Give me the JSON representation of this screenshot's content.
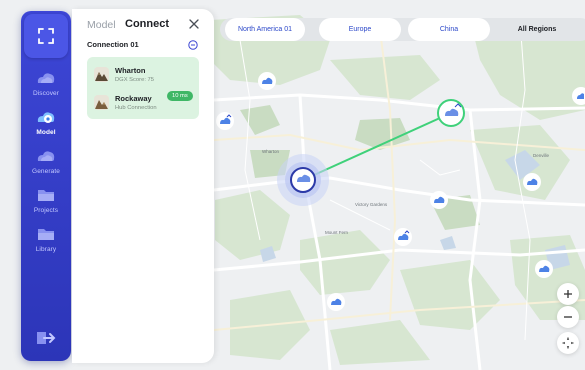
{
  "sidebar": {
    "items": [
      {
        "label": "Discover",
        "icon": "cloud-icon"
      },
      {
        "label": "Model",
        "icon": "gear-cloud-icon"
      },
      {
        "label": "Generate",
        "icon": "cloud-icon"
      },
      {
        "label": "Projects",
        "icon": "folder-icon"
      },
      {
        "label": "Library",
        "icon": "folder-icon"
      }
    ],
    "active": "Model",
    "accent": "#3b45d3"
  },
  "panel": {
    "tabs": [
      "Model",
      "Connect"
    ],
    "active_tab": "Connect",
    "connection_title": "Connection 01",
    "connection": {
      "from": {
        "name": "Wharton",
        "sub": "DGX Score: 75"
      },
      "to": {
        "name": "Rockaway",
        "sub": "Hub Connection"
      },
      "latency": "10 ms"
    },
    "card_color": "#dcf3e1",
    "latency_color": "#3fb766"
  },
  "regions": {
    "tabs": [
      "North America 01",
      "Europe",
      "China",
      "All Regions"
    ],
    "active": "All Regions",
    "tab_text_color": "#2c48c9"
  },
  "map": {
    "labels": [
      "Wharton",
      "Victory Gardens",
      "Mount Fern",
      "Denville"
    ],
    "controls": [
      "zoom-in",
      "zoom-out",
      "recenter"
    ],
    "connection_line_color": "#3fd17a",
    "selected_ring_color": "#2c3aa8"
  }
}
